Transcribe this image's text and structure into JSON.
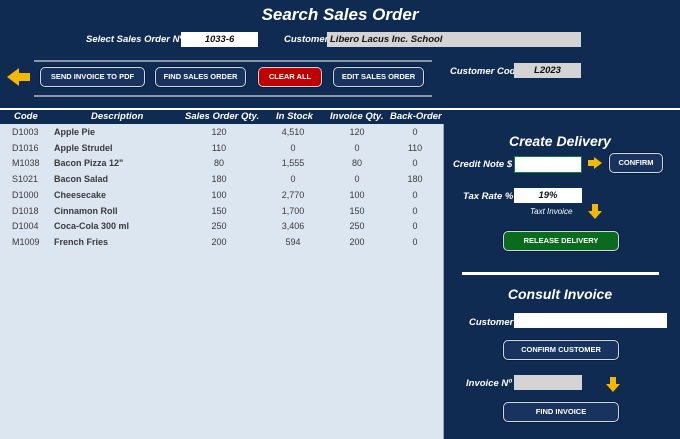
{
  "title": "Search Sales Order",
  "header": {
    "select_label": "Select Sales Order Nº",
    "order_number": "1033-6",
    "customer_label": "Customer",
    "customer_value": "Libero Lacus Inc. School",
    "customer_code_label": "Customer Code",
    "customer_code_value": "L2023"
  },
  "toolbar": {
    "send_pdf": "SEND INVOICE TO PDF",
    "find_order": "FIND SALES ORDER",
    "clear_all": "CLEAR ALL",
    "edit_order": "EDIT SALES ORDER"
  },
  "table": {
    "headers": [
      "Code",
      "Description",
      "Sales Order Qty.",
      "In Stock",
      "Invoice Qty.",
      "Back-Order"
    ],
    "rows": [
      [
        "D1003",
        "Apple Pie",
        "120",
        "4,510",
        "120",
        "0"
      ],
      [
        "D1016",
        "Apple Strudel",
        "110",
        "0",
        "0",
        "110"
      ],
      [
        "M1038",
        "Bacon Pizza 12\"",
        "80",
        "1,555",
        "80",
        "0"
      ],
      [
        "S1021",
        "Bacon Salad",
        "180",
        "0",
        "0",
        "180"
      ],
      [
        "D1000",
        "Cheesecake",
        "100",
        "2,770",
        "100",
        "0"
      ],
      [
        "D1018",
        "Cinnamon Roll",
        "150",
        "1,700",
        "150",
        "0"
      ],
      [
        "D1004",
        "Coca-Cola 300 ml",
        "250",
        "3,406",
        "250",
        "0"
      ],
      [
        "M1009",
        "French Fries",
        "200",
        "594",
        "200",
        "0"
      ]
    ]
  },
  "create_delivery": {
    "title": "Create Delivery",
    "credit_note_label": "Credit Note $",
    "credit_note_value": "",
    "confirm": "CONFIRM",
    "tax_rate_label": "Tax Rate %",
    "tax_rate_value": "19%",
    "taxt_invoice": "Taxt Invoice",
    "release_delivery": "RELEASE DELIVERY"
  },
  "consult_invoice": {
    "title": "Consult Invoice",
    "customer_label": "Customer",
    "customer_value": "",
    "confirm_customer": "CONFIRM CUSTOMER",
    "invoice_label": "Invoice Nº",
    "invoice_value": "",
    "find_invoice": "FIND INVOICE"
  },
  "colors": {
    "background": "#0f2b52",
    "table_bg": "#dce6f1",
    "accent_arrow": "#f5b800",
    "clear_button": "#c00000",
    "release_button": "#0a6b1f"
  },
  "icons": [
    "back-arrow-icon",
    "right-arrow-icon",
    "down-arrow-icon"
  ]
}
